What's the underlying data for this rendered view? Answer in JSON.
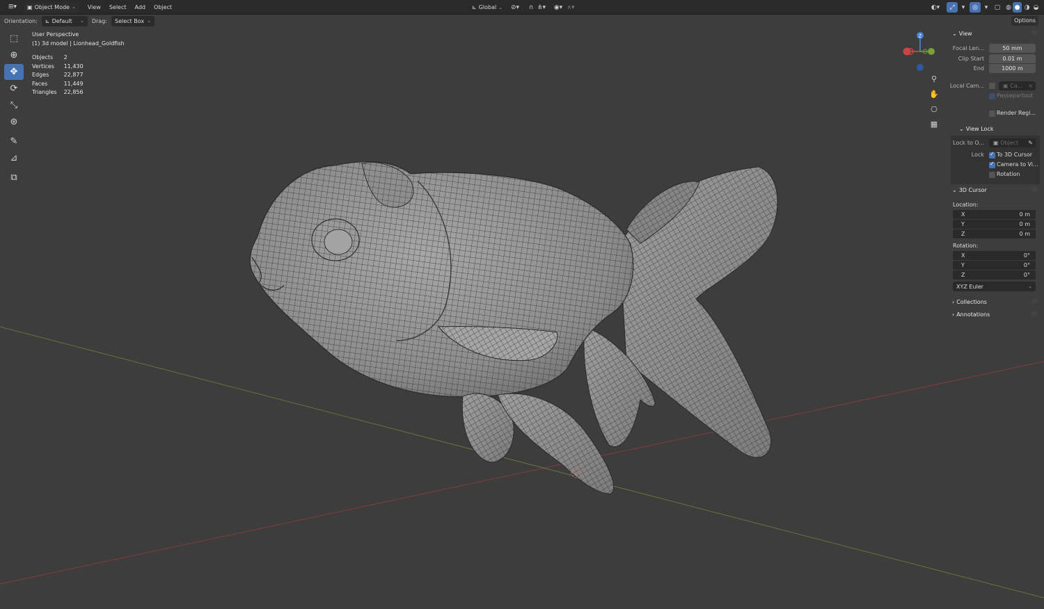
{
  "header": {
    "mode": "Object Mode",
    "menus": [
      "View",
      "Select",
      "Add",
      "Object"
    ],
    "transform_orientation": "Global"
  },
  "tool_settings": {
    "orientation_label": "Orientation:",
    "orientation_value": "Default",
    "drag_label": "Drag:",
    "drag_value": "Select Box",
    "options": "Options"
  },
  "viewport": {
    "perspective": "User Perspective",
    "object_name": "(1) 3d model | Lionhead_Goldfish",
    "stats": [
      {
        "label": "Objects",
        "value": "2"
      },
      {
        "label": "Vertices",
        "value": "11,430"
      },
      {
        "label": "Edges",
        "value": "22,877"
      },
      {
        "label": "Faces",
        "value": "11,449"
      },
      {
        "label": "Triangles",
        "value": "22,856"
      }
    ],
    "gizmo_z": "Z"
  },
  "sidebar": {
    "view": {
      "title": "View",
      "focal_label": "Focal Len...",
      "focal_value": "50 mm",
      "clip_start_label": "Clip Start",
      "clip_start_value": "0.01 m",
      "end_label": "End",
      "end_value": "1000 m",
      "local_cam_label": "Local Cam...",
      "local_cam_value": "Ca...",
      "passepartout": "Passepartout",
      "render_region": "Render Regi..."
    },
    "view_lock": {
      "title": "View Lock",
      "lock_to_label": "Lock to O...",
      "lock_to_placeholder": "Object",
      "lock_label": "Lock",
      "to_3d_cursor": "To 3D Cursor",
      "camera_to_view": "Camera to Vi...",
      "rotation": "Rotation"
    },
    "cursor": {
      "title": "3D Cursor",
      "location_label": "Location:",
      "location": [
        {
          "axis": "X",
          "value": "0 m"
        },
        {
          "axis": "Y",
          "value": "0 m"
        },
        {
          "axis": "Z",
          "value": "0 m"
        }
      ],
      "rotation_label": "Rotation:",
      "rotation": [
        {
          "axis": "X",
          "value": "0°"
        },
        {
          "axis": "Y",
          "value": "0°"
        },
        {
          "axis": "Z",
          "value": "0°"
        }
      ],
      "rotation_mode": "XYZ Euler"
    },
    "collections": "Collections",
    "annotations": "Annotations"
  }
}
